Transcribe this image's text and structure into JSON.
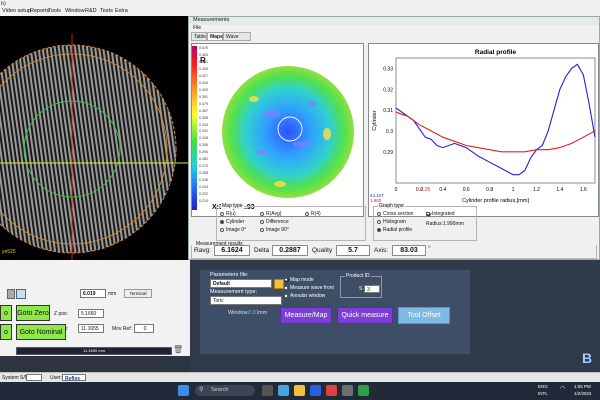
{
  "app": {
    "icon_label": "b)"
  },
  "menu": [
    "Video setup",
    "Reports",
    "Tools",
    "Window",
    "R&D",
    "Tests",
    "Extra"
  ],
  "camera": {
    "corner_label": "ye525"
  },
  "measurements": {
    "title": "Measurements",
    "file_menu": "File",
    "tabs": [
      "Table",
      "Maps",
      "Wave front"
    ],
    "active_tab": "Maps",
    "map": {
      "label": "R",
      "coord_readout": "X:3.57,Y:1.93",
      "scale_values": [
        "0.475",
        "0.463",
        "0.451",
        "0.439",
        "0.427",
        "0.415",
        "0.403",
        "0.391",
        "0.379",
        "0.367",
        "0.355",
        "0.343",
        "0.331",
        "0.318",
        "0.306",
        "0.294",
        "0.282",
        "0.270",
        "0.258",
        "0.246",
        "0.234",
        "0.222",
        "0.210"
      ]
    },
    "map_type": {
      "title": "Map type",
      "options": [
        {
          "label": "R(u)",
          "selected": false
        },
        {
          "label": "R(Avg)",
          "selected": false
        },
        {
          "label": "R(4)",
          "selected": false
        },
        {
          "label": "Cylinder",
          "selected": true
        },
        {
          "label": "Difference",
          "selected": false
        },
        {
          "label": "Image 0°",
          "selected": false
        },
        {
          "label": "Image 90°",
          "selected": false
        }
      ]
    },
    "graph_type": {
      "title": "Graph type",
      "options": [
        {
          "label": "Cross section",
          "selected": false
        },
        {
          "label": "Histogram",
          "selected": false
        },
        {
          "label": "Radial profile",
          "selected": true
        }
      ],
      "integrated_label": "Integrated",
      "integrated_checked": true,
      "radius_label": "Radius:1.990mm"
    },
    "results": {
      "title": "Measurement results",
      "ravg_label": "Ravg:",
      "ravg_value": "6.1624",
      "delta_label": "Delta",
      "delta_value": "0.2887",
      "quality_label": "Quality",
      "quality_value": "5.7",
      "axis_label": "Axis:",
      "axis_value": "83.03",
      "axis_unit": "°"
    }
  },
  "chart_data": {
    "type": "line",
    "title": "Radial profile",
    "xlabel": "Cylinder profile radius,[mm]",
    "ylabel": "Cylinder",
    "xlim": [
      0,
      1.7
    ],
    "ylim": [
      0.275,
      0.335
    ],
    "xticks": [
      "0",
      "0.2",
      "0.4",
      "0.6",
      "0.8",
      "1",
      "1.2",
      "1.4",
      "1.6"
    ],
    "yticks": [
      "0.29",
      "0.3",
      "0.31",
      "0.32",
      "0.33"
    ],
    "below_axis_readout": "44.127",
    "x_markers": [
      "0.25",
      "1.980"
    ],
    "series": [
      {
        "color": "#2020e0",
        "x": [
          0,
          0.05,
          0.1,
          0.15,
          0.2,
          0.25,
          0.3,
          0.35,
          0.4,
          0.5,
          0.6,
          0.7,
          0.8,
          0.9,
          1.0,
          1.05,
          1.1,
          1.15,
          1.2,
          1.25,
          1.3,
          1.35,
          1.4,
          1.45,
          1.5,
          1.55,
          1.6,
          1.65,
          1.7
        ],
        "y": [
          0.311,
          0.309,
          0.307,
          0.305,
          0.301,
          0.297,
          0.296,
          0.293,
          0.292,
          0.294,
          0.292,
          0.288,
          0.285,
          0.282,
          0.279,
          0.279,
          0.281,
          0.287,
          0.291,
          0.293,
          0.3,
          0.31,
          0.32,
          0.326,
          0.33,
          0.332,
          0.327,
          0.313,
          0.297
        ]
      },
      {
        "color": "#e02020",
        "x": [
          0,
          0.1,
          0.2,
          0.3,
          0.4,
          0.5,
          0.6,
          0.7,
          0.8,
          0.9,
          1.0,
          1.1,
          1.2,
          1.3,
          1.4,
          1.5,
          1.6,
          1.7
        ],
        "y": [
          0.309,
          0.307,
          0.303,
          0.3,
          0.297,
          0.295,
          0.293,
          0.292,
          0.291,
          0.29,
          0.29,
          0.29,
          0.291,
          0.291,
          0.292,
          0.294,
          0.297,
          0.3
        ]
      }
    ]
  },
  "machine": {
    "r_label": "R:",
    "r_value": "6.019",
    "r_unit": "mm",
    "terminal": "Terminal",
    "z_label": "Z pos:",
    "z_value": "5.1660",
    "n_label": "N pos:",
    "n_value": "11.1655",
    "mov_label": "Mov Ref:",
    "mov_value": "0",
    "goto_zero": "Goto Zero",
    "goto_nominal": "Goto Nominal",
    "side_o1": "o",
    "side_o2": "o",
    "progress_value": "11.1650 mm"
  },
  "params": {
    "file_label": "Parameters file:",
    "file_value": "Default",
    "type_label": "Measurement type:",
    "type_value": "Toric",
    "window_label": "Window:",
    "window_value": "2.01",
    "window_unit": "mm",
    "map_mode": "Map mode",
    "map_mode_checked": true,
    "wave_front": "Measure wave front",
    "wave_front_checked": false,
    "annular": "Annular window",
    "annular_checked": false,
    "product_label": "Product ID",
    "product_s": "S",
    "product_value": "3",
    "btn_measure_map": "Measure/Map",
    "btn_quick": "Quick measure",
    "btn_tool": "Tool Offset"
  },
  "logo_letter": "B",
  "status": {
    "system_sn_label": "System S/N:",
    "user_label": "User:",
    "user_value": "Reflex"
  },
  "taskbar": {
    "search_placeholder": "Search",
    "tray_lang": "ENG",
    "tray_region": "INTL",
    "clock_time": "1:55 PM",
    "clock_date": "1/2/2024"
  }
}
